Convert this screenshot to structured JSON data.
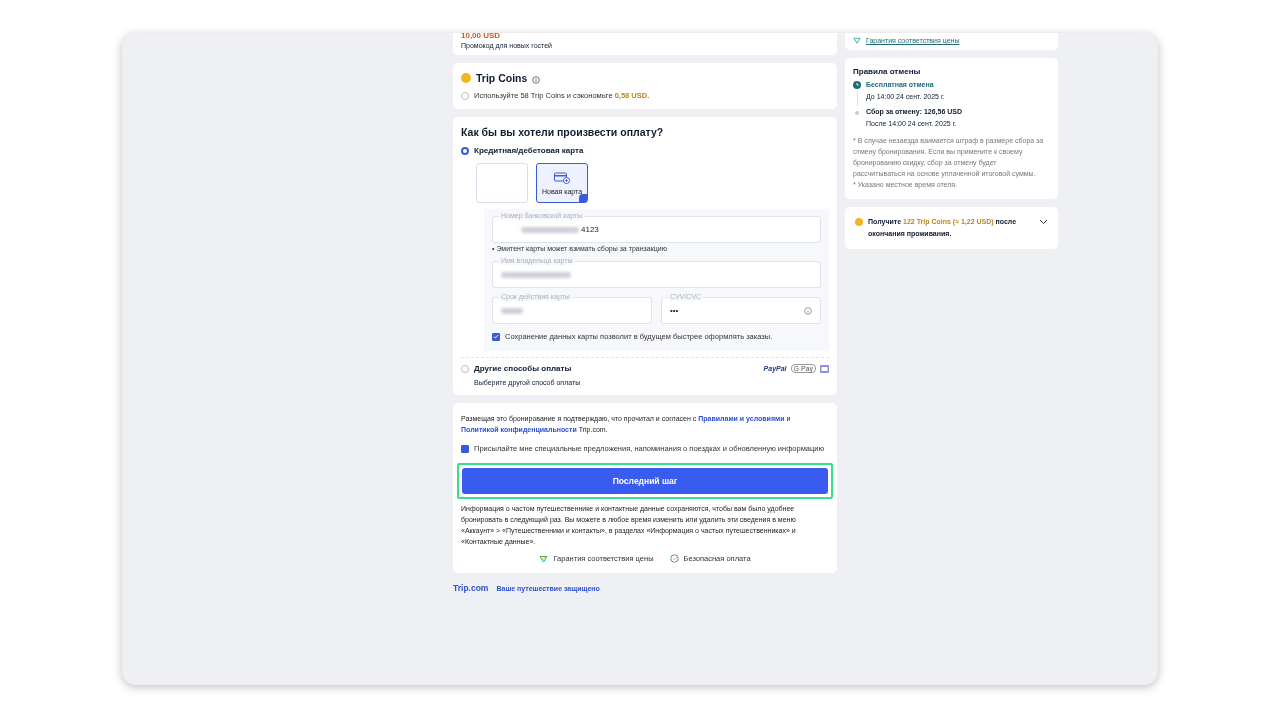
{
  "promo": {
    "amount": "10,00 USD",
    "caption": "Промокод для новых гостей"
  },
  "trip_coins": {
    "title": "Trip Coins",
    "option": {
      "text": "Используйте 58 Trip Coins и сэкономьте",
      "amount": "0,58 USD.",
      "selected": false
    }
  },
  "payment": {
    "title": "Как бы вы хотели произвести оплату?",
    "methods": [
      {
        "kind": "card",
        "label": "Кредитная/дебетовая карта",
        "selected": true
      },
      {
        "kind": "other",
        "label": "Другие способы оплаты",
        "hint": "Выберите другой способ оплаты",
        "selected": false,
        "badges": [
          "PayPal",
          "G Pay"
        ]
      }
    ],
    "card_tiles": [
      {
        "kind": "blank",
        "selected": false
      },
      {
        "kind": "new",
        "label": "Новая карта",
        "selected": true
      }
    ],
    "card_number": {
      "label": "Номер банковской карты",
      "value": "4123"
    },
    "issuer_note": "• Эмитент карты может взимать сборы за транзакцию",
    "holder": {
      "label": "Имя владельца карты"
    },
    "expiry": {
      "label": "Срок действия карты"
    },
    "cvv": {
      "label": "CVV/CVC",
      "value": "•••"
    },
    "save_card": {
      "checked": true,
      "text": "Сохранение данных карты позволит в будущем быстрее оформлять заказы."
    }
  },
  "terms": {
    "text": "Размещая это бронирование я подтверждаю, что прочитал и согласен с",
    "link1": "Правилами и условиями",
    "and": "и",
    "link2": "Политикой конфиденциальности",
    "tail": "Trip.com."
  },
  "newsletter": {
    "checked": true,
    "text": "Присылайте мне специальные предложения, напоминания о поездках и обновленную информацию"
  },
  "submit": {
    "label": "Последний шаг",
    "highlighted": true
  },
  "info": "Информация о частом путешественнике и контактные данные сохраняются, чтобы вам было удобнее бронировать в следующий раз. Вы можете в любое время изменить или удалить эти сведения в меню «Аккаунт» > «Путешественники и контакты», в разделах «Информация о частых путешественниках» и «Контактные данные».",
  "assurances": [
    {
      "kind": "price",
      "text": "Гарантия соответствия цены"
    },
    {
      "kind": "secure",
      "text": "Безопасная оплата"
    }
  ],
  "footer": {
    "logo": "Trip.com",
    "tagline": "Ваше путешествие защищено"
  },
  "sidebar": {
    "price_guarantee": "Гарантия соответствия цены",
    "cancellation": {
      "title": "Правила отмены",
      "steps": [
        {
          "kind": "free",
          "title": "Бесплатная отмена",
          "detail": "До 14:00 24 сент. 2025 г."
        },
        {
          "kind": "fee",
          "title": "Сбор за отмену: 126,56 USD",
          "detail": "После 14:00 24 сент. 2025 г."
        }
      ],
      "notes": [
        "* В случае незаезда взимается штраф в размере сбора за отмену бронирования. Если вы примените к своему бронированию скидку, сбор за отмену будет рассчитываться на основе уплаченной итоговой суммы.",
        "* Указано местное время отеля."
      ]
    },
    "reward": {
      "before": "Получите",
      "highlight": "122 Trip Coins (≈ 1,22 USD)",
      "after": "после окончания проживания."
    }
  }
}
